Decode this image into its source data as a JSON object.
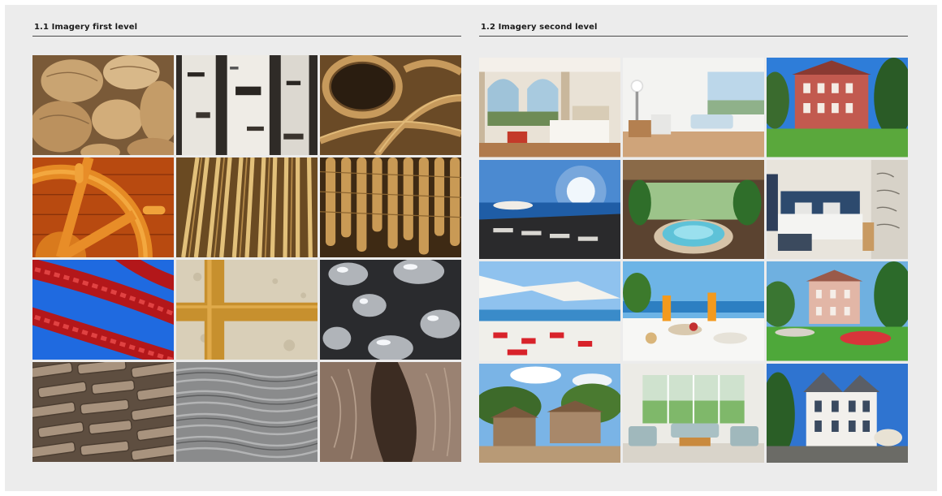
{
  "sections": [
    {
      "heading": "1.1 Imagery first level",
      "tiles": [
        {
          "subject": "stones"
        },
        {
          "subject": "birch-bark"
        },
        {
          "subject": "coiled-rope"
        },
        {
          "subject": "ship-wheel"
        },
        {
          "subject": "wooden-slats"
        },
        {
          "subject": "rope-strands"
        },
        {
          "subject": "red-braided-rope"
        },
        {
          "subject": "wood-cross-plaster"
        },
        {
          "subject": "glass-bubble-lamps"
        },
        {
          "subject": "stone-wall"
        },
        {
          "subject": "raked-sand"
        },
        {
          "subject": "tree-bark"
        }
      ]
    },
    {
      "heading": "1.2 Imagery second level",
      "tiles": [
        {
          "subject": "hotel-bedroom-arched-windows"
        },
        {
          "subject": "bright-lounge"
        },
        {
          "subject": "red-villa-garden"
        },
        {
          "subject": "seaside-terrace-sunset"
        },
        {
          "subject": "indoor-whirlpool-pool"
        },
        {
          "subject": "bedroom-blue-headboard"
        },
        {
          "subject": "beach-umbrellas-sunbeds"
        },
        {
          "subject": "breakfast-by-the-sea"
        },
        {
          "subject": "pink-villa-garden"
        },
        {
          "subject": "stone-village"
        },
        {
          "subject": "living-room-garden-view"
        },
        {
          "subject": "white-villa-blue-sky"
        }
      ]
    }
  ]
}
